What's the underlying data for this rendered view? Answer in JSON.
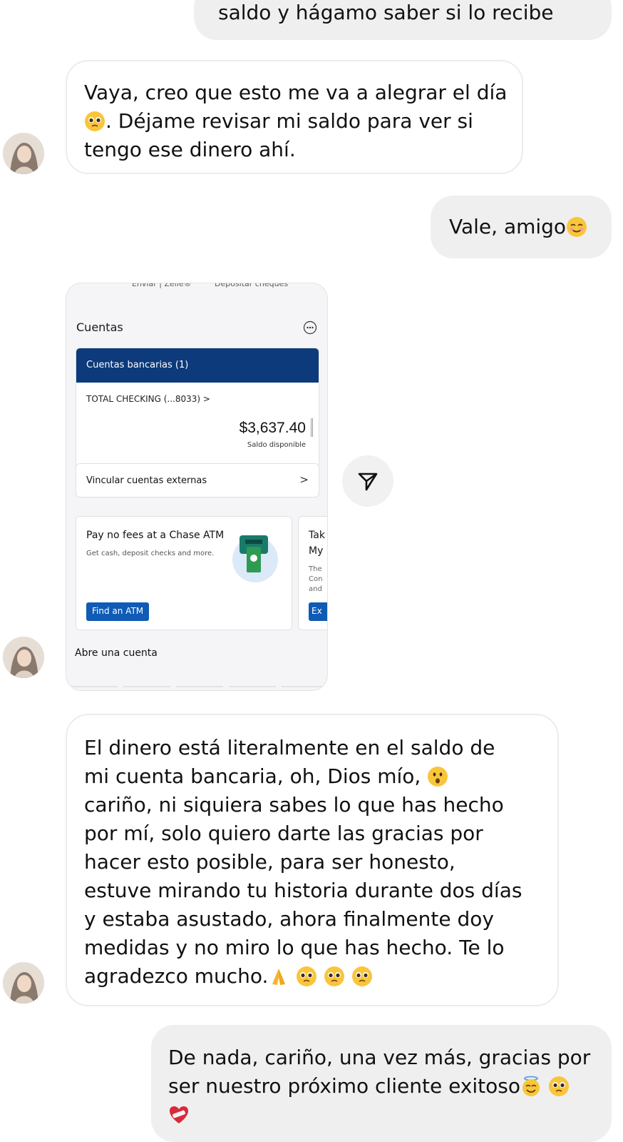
{
  "messages": {
    "top_partial": "saldo y hágamo saber si lo recibe",
    "m1": {
      "lines": [
        "Vaya, creo que esto me va a alegrar el día",
        ". Déjame revisar mi saldo para ver si",
        "tengo ese dinero ahí."
      ]
    },
    "m2": {
      "text": "Vale, amigo"
    },
    "m3": {
      "lines": [
        "El dinero está literalmente en el saldo de",
        "mi cuenta bancaria, oh, Dios mío,",
        "cariño, ni siquiera sabes lo que has hecho",
        "por mí, solo quiero darte las gracias por",
        "hacer esto posible, para ser honesto,",
        "estuve mirando tu historia durante dos días",
        "y estaba asustado, ahora finalmente doy",
        "medidas y no miro lo que has hecho. Te lo",
        "agradezco mucho."
      ]
    },
    "m4": {
      "lines": [
        "De nada, cariño, una vez más, gracias por",
        "ser nuestro próximo cliente exitoso"
      ]
    }
  },
  "shared_screenshot": {
    "top_tabs": [
      "Enviar | Zelle®",
      "Depositar cheques"
    ],
    "section_title": "Cuentas",
    "account_header": "Cuentas bancarias (1)",
    "account_name": "TOTAL CHECKING (...8033) >",
    "balance": "$3,637.40",
    "balance_label": "Saldo disponible",
    "link_accounts": "Vincular cuentas externas",
    "link_chevron": ">",
    "promo_title": "Pay no fees at a Chase ATM",
    "promo_sub": "Get cash, deposit checks and more.",
    "promo_button": "Find an ATM",
    "promo2_lines": [
      "Tak",
      "My",
      "The",
      "Con",
      "and"
    ],
    "promo2_button": "Ex",
    "footer_title": "Abre una cuenta"
  },
  "icons": {
    "avatar": "avatar",
    "emoji_pleading": "pleading-face-icon",
    "emoji_smile": "smiling-face-icon",
    "emoji_hushed": "hushed-face-icon",
    "emoji_pray": "folded-hands-icon",
    "emoji_halo": "halo-face-icon",
    "emoji_heart": "mending-heart-icon",
    "share": "share-send-icon",
    "more": "more-horizontal-icon"
  },
  "colors": {
    "incoming_bubble": "#ffffff",
    "outgoing_bubble": "#efefef",
    "chase_blue": "#0c3a7b",
    "button_blue": "#0f5bb5"
  }
}
